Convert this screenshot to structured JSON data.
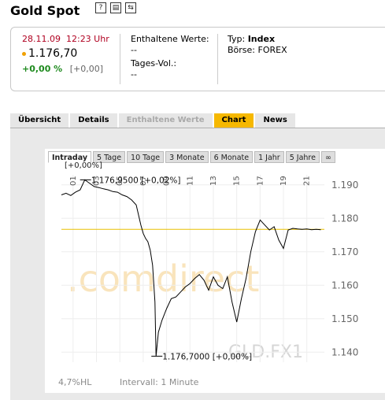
{
  "header": {
    "title": "Gold Spot",
    "icons": [
      "help-icon",
      "print-icon",
      "switch-icon"
    ]
  },
  "quote": {
    "date": "28.11.09",
    "time": "12:23 Uhr",
    "price": "1.176,70",
    "change_pct": "+0,00 %",
    "change_abs": "[+0,00]",
    "contained_label": "Enthaltene Werte:",
    "contained_value": "--",
    "volume_label": "Tages-Vol.:",
    "volume_value": "--",
    "type_label": "Typ:",
    "type_value": "Index",
    "exchange_label": "Börse:",
    "exchange_value": "FOREX",
    "colors": {
      "date": "#b00020",
      "change": "#1e8a1e",
      "bullet": "#f0a000"
    }
  },
  "tabs": [
    {
      "label": "Übersicht",
      "state": "normal"
    },
    {
      "label": "Details",
      "state": "normal"
    },
    {
      "label": "Enthaltene Werte",
      "state": "disabled"
    },
    {
      "label": "Chart",
      "state": "active"
    },
    {
      "label": "News",
      "state": "normal"
    }
  ],
  "ranges": {
    "items": [
      "Intraday",
      "5 Tage",
      "10 Tage",
      "3 Monate",
      "6 Monate",
      "1 Jahr",
      "5 Jahre",
      "∞"
    ],
    "selected": "Intraday"
  },
  "footer": {
    "left": "4,7%HL",
    "right": "Intervall: 1 Minute"
  },
  "watermark": {
    "brand": ".comdirect",
    "symbol": "GLD.FX1"
  },
  "chart_data": {
    "type": "line",
    "x_ticks": [
      "01",
      "03",
      "05",
      "07",
      "09",
      "11",
      "13",
      "15",
      "17",
      "19",
      "21"
    ],
    "y_ticks": [
      "1.190",
      "1.180",
      "1.170",
      "1.160",
      "1.150",
      "1.140"
    ],
    "ylim": [
      1.137,
      1.193
    ],
    "xlim": [
      0,
      22.5
    ],
    "reference_line": 1.1767,
    "reference_color": "#e8c000",
    "top_label": "[+0,00%]",
    "annotations": [
      {
        "text": "1.176,9500 [+0,02%]",
        "x": 2.0,
        "y": 1.1915
      },
      {
        "text": "1.176,7000 [+0,00%]",
        "x": 8.1,
        "y": 1.1388
      }
    ],
    "series": [
      {
        "x": [
          0,
          0.4,
          0.8,
          1.2,
          1.6,
          2.0,
          2.4,
          2.8,
          3.2,
          3.6,
          4.0,
          4.4,
          4.8,
          5.2,
          5.6,
          6.0,
          6.4,
          6.8,
          7.0,
          7.2,
          7.4,
          7.6,
          7.8,
          8.0,
          8.1,
          8.3,
          8.6,
          9.0,
          9.4,
          9.8,
          10.2,
          10.6,
          11.0,
          11.4,
          11.8,
          12.2,
          12.6,
          13.0,
          13.4,
          13.8,
          14.2,
          14.6,
          15.0,
          15.4,
          15.8,
          16.2,
          16.6,
          17.0,
          17.4,
          17.8,
          18.2,
          18.6,
          19.0,
          19.4,
          19.8,
          20.2,
          20.6,
          21.0,
          21.4,
          21.8,
          22.2
        ],
        "y": [
          1.187,
          1.1875,
          1.1868,
          1.1878,
          1.1885,
          1.1915,
          1.1905,
          1.1895,
          1.1892,
          1.1888,
          1.1885,
          1.188,
          1.1878,
          1.187,
          1.1865,
          1.1855,
          1.184,
          1.178,
          1.1755,
          1.174,
          1.173,
          1.1705,
          1.166,
          1.155,
          1.1388,
          1.146,
          1.1495,
          1.153,
          1.156,
          1.1565,
          1.158,
          1.1595,
          1.1605,
          1.162,
          1.1632,
          1.1615,
          1.1585,
          1.1625,
          1.16,
          1.159,
          1.1625,
          1.155,
          1.149,
          1.156,
          1.162,
          1.17,
          1.176,
          1.1795,
          1.178,
          1.1765,
          1.1775,
          1.1735,
          1.171,
          1.1765,
          1.177,
          1.1768,
          1.1767,
          1.1768,
          1.1766,
          1.1767,
          1.1766
        ]
      }
    ]
  }
}
